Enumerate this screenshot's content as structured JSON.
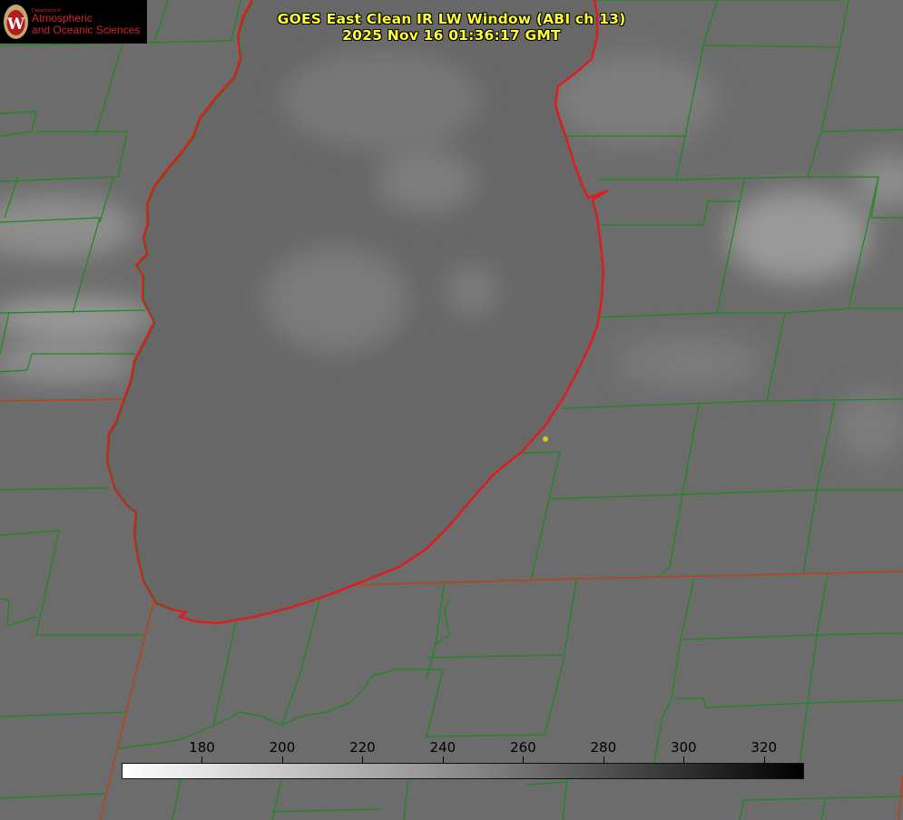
{
  "title": {
    "line1": "GOES East Clean IR LW Window (ABI ch 13)",
    "line2": "2025 Nov 16 01:36:17 GMT"
  },
  "logo": {
    "dept": "Department of",
    "line1": "Atmospheric",
    "line2": "and Oceanic Sciences",
    "seal_letter": "W"
  },
  "colorbar": {
    "min": 160,
    "max": 330,
    "ticks": [
      "180",
      "200",
      "220",
      "240",
      "260",
      "280",
      "300",
      "320"
    ],
    "tick_values": [
      180,
      200,
      220,
      240,
      260,
      280,
      300,
      320
    ]
  },
  "colors": {
    "county_lines": "#1a8a1a",
    "state_lines": "#b5451b",
    "coastline": "#e41a1a",
    "title": "#ffff33",
    "marker": "#d4c81e",
    "brand_red": "#d2232a"
  }
}
